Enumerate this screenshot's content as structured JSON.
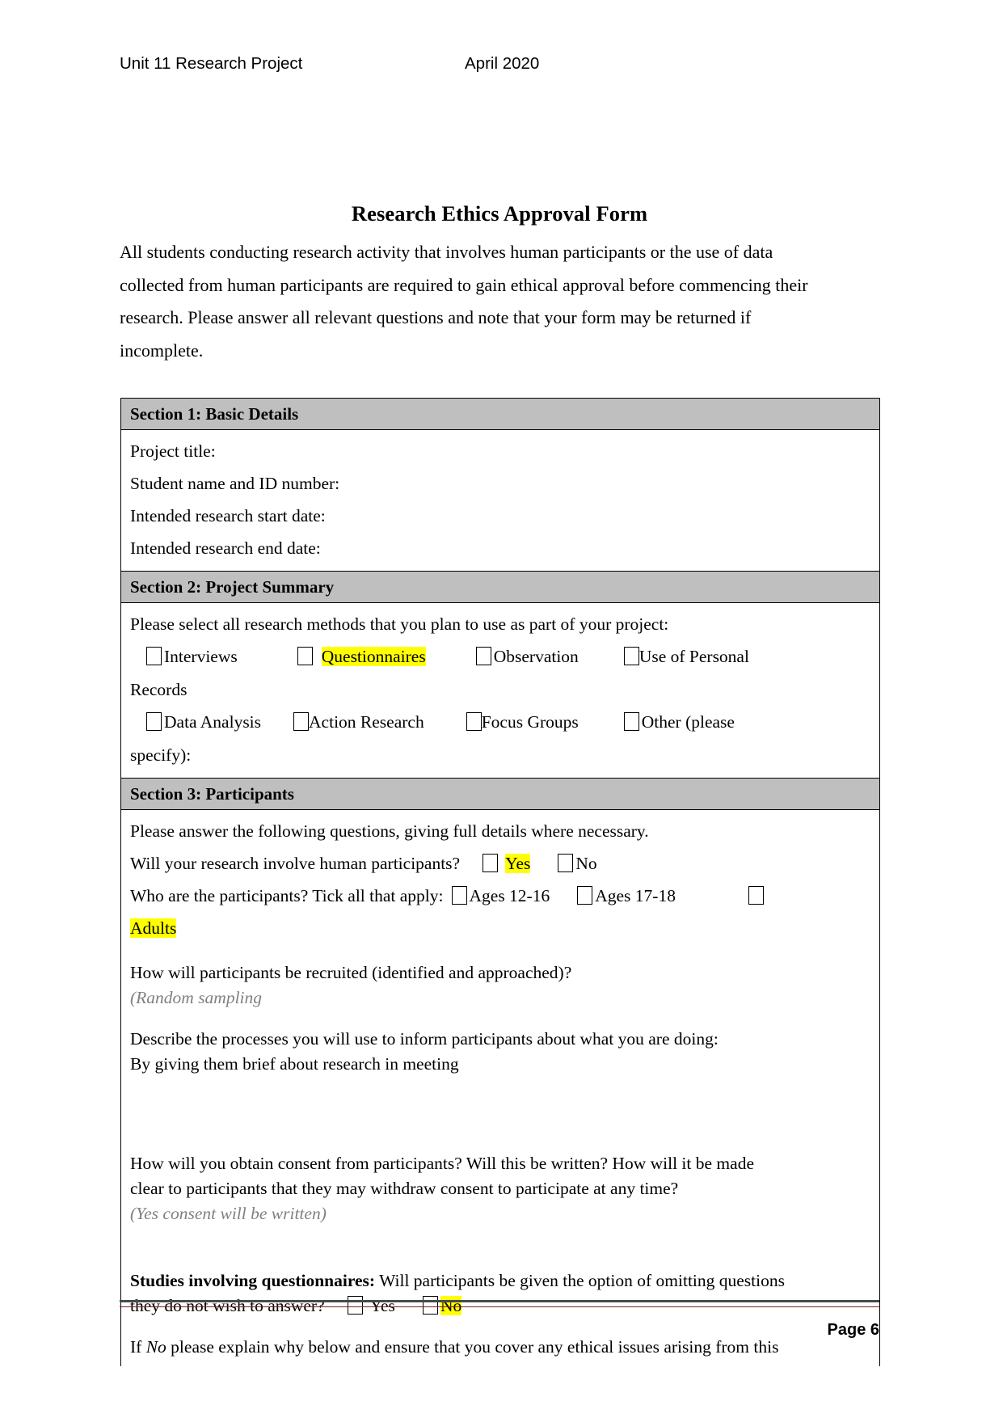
{
  "header": {
    "left": "Unit 11 Research Project",
    "right": "April 2020"
  },
  "title": "Research Ethics Approval Form",
  "intro": {
    "line1": "All students conducting research activity that involves human participants or the use of data",
    "line2": "collected from human participants are required to gain ethical approval before commencing their",
    "line3": "research. Please answer all relevant questions and note that your form may be returned if",
    "line4": "incomplete."
  },
  "sections": {
    "section1": {
      "heading": "Section 1: Basic Details",
      "fields": [
        "Project title:",
        "Student name and ID number:",
        "Intended research start date:",
        "Intended research end date:"
      ]
    },
    "section2": {
      "heading": "Section 2: Project Summary",
      "prompt": "Please select all research methods that you plan to use as part of your project:",
      "methods_row1": [
        {
          "label": "Interviews",
          "highlighted": false
        },
        {
          "label": "Questionnaires",
          "highlighted": true
        },
        {
          "label": "Observation",
          "highlighted": false
        },
        {
          "label": "Use of Personal",
          "highlighted": false
        }
      ],
      "methods_row1_wrap": "Records",
      "methods_row2": [
        {
          "label": "Data Analysis",
          "highlighted": false
        },
        {
          "label": "Action Research",
          "highlighted": false
        },
        {
          "label": "Focus Groups",
          "highlighted": false
        },
        {
          "label": "Other (please",
          "highlighted": false
        }
      ],
      "methods_row2_wrap": "specify):"
    },
    "section3": {
      "heading": "Section 3: Participants",
      "prompt": "Please answer the following questions, giving full details where necessary.",
      "q_human": {
        "text": "Will your research involve human participants?",
        "yes": "Yes",
        "yes_highlighted": true,
        "no": "No",
        "no_highlighted": false
      },
      "q_who": {
        "text": "Who are the participants? Tick all that apply:",
        "opt1": "Ages 12-16",
        "opt2": "Ages 17-18",
        "opt3": "Adults",
        "opt3_highlighted": true
      },
      "q_recruit": {
        "question": "How will participants be recruited (identified and approached)?",
        "answer": "(Random sampling"
      },
      "q_inform": {
        "question": "Describe the processes you will use to inform participants about what you are doing:",
        "answer": "By giving them brief about research in meeting"
      },
      "q_consent": {
        "question_line1": "How will you obtain consent from participants? Will this be written? How will it be made",
        "question_line2": "clear to participants that they may withdraw consent to participate at any time?",
        "answer": "(Yes consent will be written)"
      },
      "q_questionnaires": {
        "bold_lead": "Studies involving questionnaires:",
        "rest_line1": " Will participants be given the option of omitting questions",
        "rest_line2": "they do not wish to answer?",
        "yes": "Yes",
        "yes_highlighted": false,
        "no": "No",
        "no_highlighted": true
      },
      "q_ifno": {
        "pre": "If ",
        "italic": "No",
        "post": " please explain why below and ensure that you cover any ethical issues arising from this"
      }
    }
  },
  "footer": {
    "page": "Page 6"
  },
  "colors": {
    "section_header_bg": "#bfbfbf",
    "highlight": "#ffff00",
    "answer_text": "#808080",
    "footer_rule_dark": "#4a4a4a",
    "footer_rule_red": "#7b2020"
  }
}
